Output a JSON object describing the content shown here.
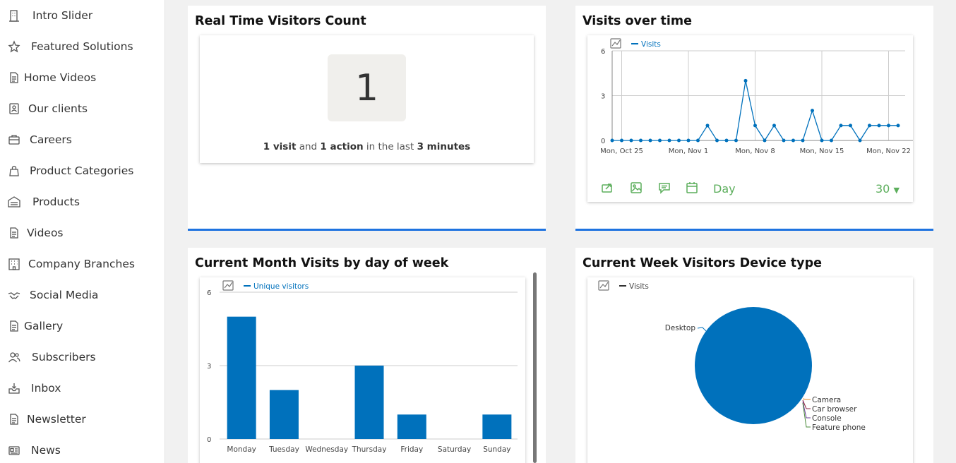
{
  "sidebar": {
    "items": [
      {
        "label": "Intro Slider",
        "icon": "building-icon"
      },
      {
        "label": "Featured Solutions",
        "icon": "star-icon"
      },
      {
        "label": "Home Videos",
        "icon": "document-icon"
      },
      {
        "label": "Our clients",
        "icon": "contact-card-icon"
      },
      {
        "label": "Careers",
        "icon": "briefcase-icon"
      },
      {
        "label": "Product Categories",
        "icon": "shopping-bag-icon"
      },
      {
        "label": "Products",
        "icon": "warehouse-icon"
      },
      {
        "label": "Videos",
        "icon": "document-icon"
      },
      {
        "label": "Company Branches",
        "icon": "office-building-icon"
      },
      {
        "label": "Social Media",
        "icon": "handshake-icon"
      },
      {
        "label": "Gallery",
        "icon": "document-icon"
      },
      {
        "label": "Subscribers",
        "icon": "users-icon"
      },
      {
        "label": "Inbox",
        "icon": "inbox-icon"
      },
      {
        "label": "Newsletter",
        "icon": "document-icon"
      },
      {
        "label": "News",
        "icon": "newspaper-icon"
      }
    ]
  },
  "realtime": {
    "title": "Real Time Visitors Count",
    "count": "1",
    "visits": "1 visit",
    "and": " and ",
    "actions": "1 action",
    "in_the_last": " in the last ",
    "minutes": "3 minutes"
  },
  "visits_over_time": {
    "title": "Visits over time",
    "legend": "Visits",
    "period": "Day",
    "limit": "30",
    "footer_icons": [
      "export-icon",
      "image-icon",
      "annotation-icon",
      "calendar-icon"
    ]
  },
  "weekday": {
    "title": "Current Month Visits by day of week",
    "legend": "Unique visitors"
  },
  "device": {
    "title": "Current Week Visitors Device type",
    "legend": "Visits"
  },
  "colors": {
    "series": "#0071bc",
    "accent_border": "#1e73e0",
    "footer_green": "#5cae5c"
  },
  "chart_data": [
    {
      "type": "line",
      "title": "Visits over time",
      "x": [
        "Oct 24",
        "Oct 25",
        "Oct 26",
        "Oct 27",
        "Oct 28",
        "Oct 29",
        "Oct 30",
        "Oct 31",
        "Nov 1",
        "Nov 2",
        "Nov 3",
        "Nov 4",
        "Nov 5",
        "Nov 6",
        "Nov 7",
        "Nov 8",
        "Nov 9",
        "Nov 10",
        "Nov 11",
        "Nov 12",
        "Nov 13",
        "Nov 14",
        "Nov 15",
        "Nov 16",
        "Nov 17",
        "Nov 18",
        "Nov 19",
        "Nov 20",
        "Nov 21",
        "Nov 22",
        "Nov 23"
      ],
      "series": [
        {
          "name": "Visits",
          "values": [
            0,
            0,
            0,
            0,
            0,
            0,
            0,
            0,
            0,
            0,
            1,
            0,
            0,
            0,
            4,
            1,
            0,
            1,
            0,
            0,
            0,
            2,
            0,
            0,
            1,
            1,
            0,
            1,
            1,
            1,
            1
          ]
        }
      ],
      "xtick_labels": [
        "Mon, Oct 25",
        "Mon, Nov 1",
        "Mon, Nov 8",
        "Mon, Nov 15",
        "Mon, Nov 22"
      ],
      "yticks": [
        0,
        3,
        6
      ],
      "ylim": [
        0,
        6
      ],
      "grid": true
    },
    {
      "type": "bar",
      "title": "Current Month Visits by day of week",
      "categories": [
        "Monday",
        "Tuesday",
        "Wednesday",
        "Thursday",
        "Friday",
        "Saturday",
        "Sunday"
      ],
      "series": [
        {
          "name": "Unique visitors",
          "values": [
            5,
            2,
            0,
            3,
            1,
            0,
            1
          ]
        }
      ],
      "yticks": [
        0,
        3,
        6
      ],
      "ylim": [
        0,
        6
      ],
      "grid": true
    },
    {
      "type": "pie",
      "title": "Current Week Visitors Device type",
      "series": [
        {
          "name": "Visits"
        }
      ],
      "labels": [
        "Desktop",
        "Camera",
        "Car browser",
        "Console",
        "Feature phone"
      ],
      "values": [
        100,
        0,
        0,
        0,
        0
      ]
    }
  ]
}
